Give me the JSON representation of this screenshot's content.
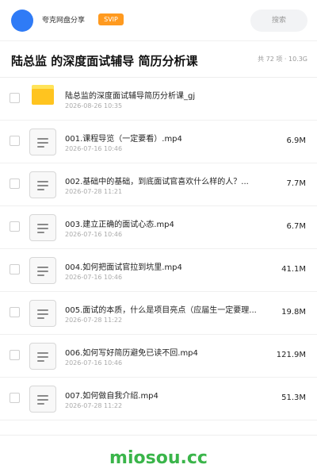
{
  "header": {
    "share_name": "夸克网盘分享",
    "badge": "SVIP",
    "search_label": "搜索"
  },
  "folder": {
    "title": "陆总监 的深度面试辅导 简历分析课",
    "summary": "共 72 项 · 10.3G"
  },
  "files": [
    {
      "name": "陆总监的深度面试辅导简历分析课_gj",
      "date": "2026-08-26 10:35",
      "size": "",
      "icon": "folder-icon"
    },
    {
      "name": "001.课程导览（一定要看）.mp4",
      "date": "2026-07-16 10:46",
      "size": "6.9M",
      "icon": "file-icon"
    },
    {
      "name": "002.基础中的基础，到底面试官喜欢什么样的人？...",
      "date": "2026-07-28 11:21",
      "size": "7.7M",
      "icon": "file-icon"
    },
    {
      "name": "003.建立正确的面试心态.mp4",
      "date": "2026-07-16 10:46",
      "size": "6.7M",
      "icon": "file-icon"
    },
    {
      "name": "004.如何把面试官拉到坑里.mp4",
      "date": "2026-07-16 10:46",
      "size": "41.1M",
      "icon": "file-icon"
    },
    {
      "name": "005.面试的本质，什么是项目亮点（应届生一定要理...",
      "date": "2026-07-28 11:22",
      "size": "19.8M",
      "icon": "file-icon"
    },
    {
      "name": "006.如何写好简历避免已读不回.mp4",
      "date": "2026-07-16 10:46",
      "size": "121.9M",
      "icon": "file-icon"
    },
    {
      "name": "007.如何做自我介绍.mp4",
      "date": "2026-07-28 11:22",
      "size": "51.3M",
      "icon": "file-icon"
    }
  ],
  "watermark": "miosou.cc",
  "colors": {
    "avatar": "#2f7bf6",
    "badge": "#ff9a1f",
    "folder": "#ffc41f",
    "watermark": "#3ab54a"
  }
}
